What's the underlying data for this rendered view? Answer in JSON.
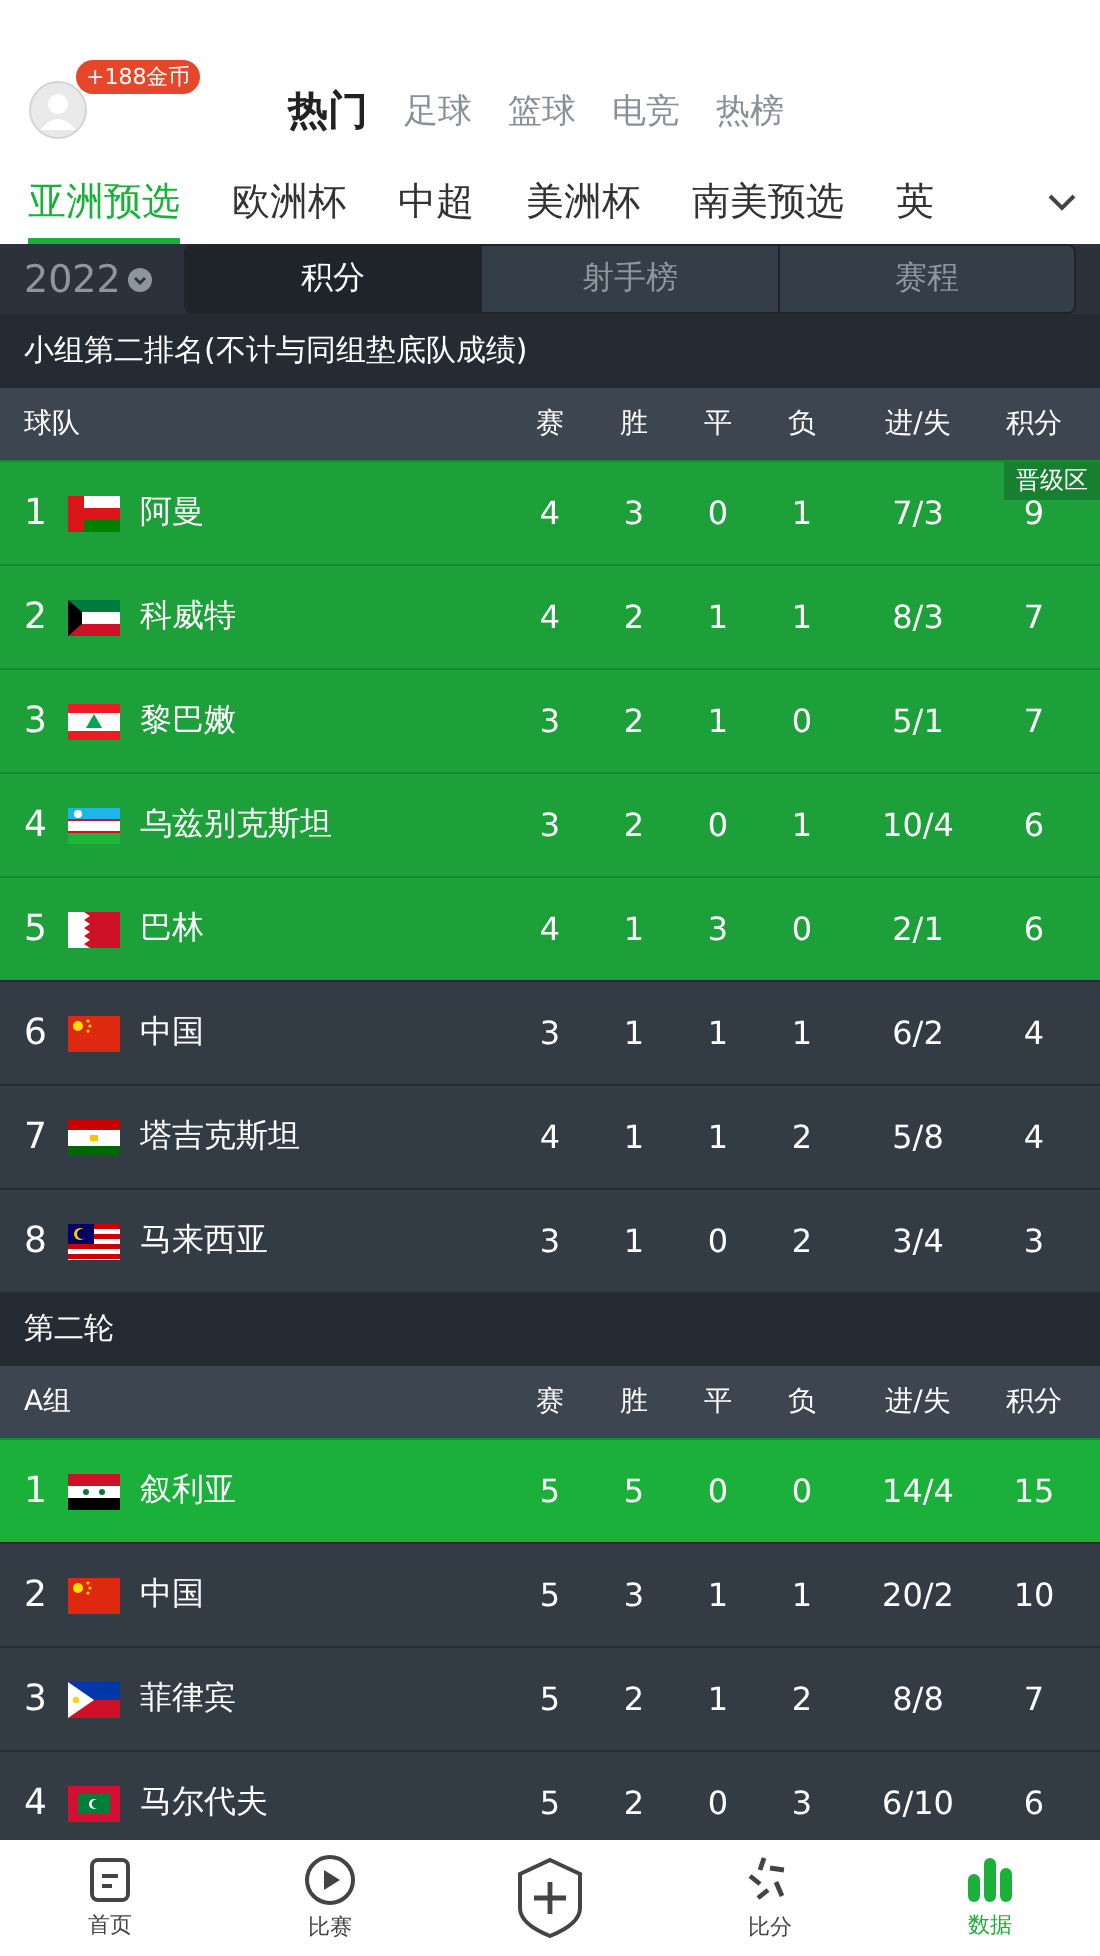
{
  "header": {
    "coins_badge": "+188金币",
    "tabs": [
      {
        "label": "热门",
        "selected": true
      },
      {
        "label": "足球",
        "selected": false
      },
      {
        "label": "篮球",
        "selected": false
      },
      {
        "label": "电竞",
        "selected": false
      },
      {
        "label": "热榜",
        "selected": false
      }
    ]
  },
  "league_tabs": [
    {
      "label": "亚洲预选",
      "selected": true
    },
    {
      "label": "欧洲杯",
      "selected": false
    },
    {
      "label": "中超",
      "selected": false
    },
    {
      "label": "美洲杯",
      "selected": false
    },
    {
      "label": "南美预选",
      "selected": false
    },
    {
      "label": "英",
      "selected": false
    }
  ],
  "season": "2022",
  "view_tabs": [
    {
      "label": "积分",
      "selected": true
    },
    {
      "label": "射手榜",
      "selected": false
    },
    {
      "label": "赛程",
      "selected": false
    }
  ],
  "sections": [
    {
      "title": "小组第二排名(不计与同组垫底队成绩)",
      "columns": [
        "球队",
        "赛",
        "胜",
        "平",
        "负",
        "进/失",
        "积分"
      ],
      "rows": [
        {
          "rank": "1",
          "cells": [
            "阿曼",
            "4",
            "3",
            "0",
            "1",
            "7/3",
            "9"
          ],
          "qualified": true,
          "badge": "晋级区"
        },
        {
          "rank": "2",
          "cells": [
            "科威特",
            "4",
            "2",
            "1",
            "1",
            "8/3",
            "7"
          ],
          "qualified": true
        },
        {
          "rank": "3",
          "cells": [
            "黎巴嫩",
            "3",
            "2",
            "1",
            "0",
            "5/1",
            "7"
          ],
          "qualified": true
        },
        {
          "rank": "4",
          "cells": [
            "乌兹别克斯坦",
            "3",
            "2",
            "0",
            "1",
            "10/4",
            "6"
          ],
          "qualified": true
        },
        {
          "rank": "5",
          "cells": [
            "巴林",
            "4",
            "1",
            "3",
            "0",
            "2/1",
            "6"
          ],
          "qualified": true
        },
        {
          "rank": "6",
          "cells": [
            "中国",
            "3",
            "1",
            "1",
            "1",
            "6/2",
            "4"
          ],
          "qualified": false
        },
        {
          "rank": "7",
          "cells": [
            "塔吉克斯坦",
            "4",
            "1",
            "1",
            "2",
            "5/8",
            "4"
          ],
          "qualified": false
        },
        {
          "rank": "8",
          "cells": [
            "马来西亚",
            "3",
            "1",
            "0",
            "2",
            "3/4",
            "3"
          ],
          "qualified": false
        }
      ]
    },
    {
      "title": "第二轮",
      "columns": [
        "A组",
        "赛",
        "胜",
        "平",
        "负",
        "进/失",
        "积分"
      ],
      "rows": [
        {
          "rank": "1",
          "cells": [
            "叙利亚",
            "5",
            "5",
            "0",
            "0",
            "14/4",
            "15"
          ],
          "qualified": true
        },
        {
          "rank": "2",
          "cells": [
            "中国",
            "5",
            "3",
            "1",
            "1",
            "20/2",
            "10"
          ],
          "qualified": false
        },
        {
          "rank": "3",
          "cells": [
            "菲律宾",
            "5",
            "2",
            "1",
            "2",
            "8/8",
            "7"
          ],
          "qualified": false
        },
        {
          "rank": "4",
          "cells": [
            "马尔代夫",
            "5",
            "2",
            "0",
            "3",
            "6/10",
            "6"
          ],
          "qualified": false
        }
      ]
    }
  ],
  "bottom_nav": [
    {
      "kind": "home",
      "label": "首页",
      "selected": false
    },
    {
      "kind": "play",
      "label": "比赛",
      "selected": false
    },
    {
      "kind": "add"
    },
    {
      "kind": "score",
      "label": "比分",
      "selected": false
    },
    {
      "kind": "data",
      "label": "数据",
      "selected": true
    }
  ]
}
